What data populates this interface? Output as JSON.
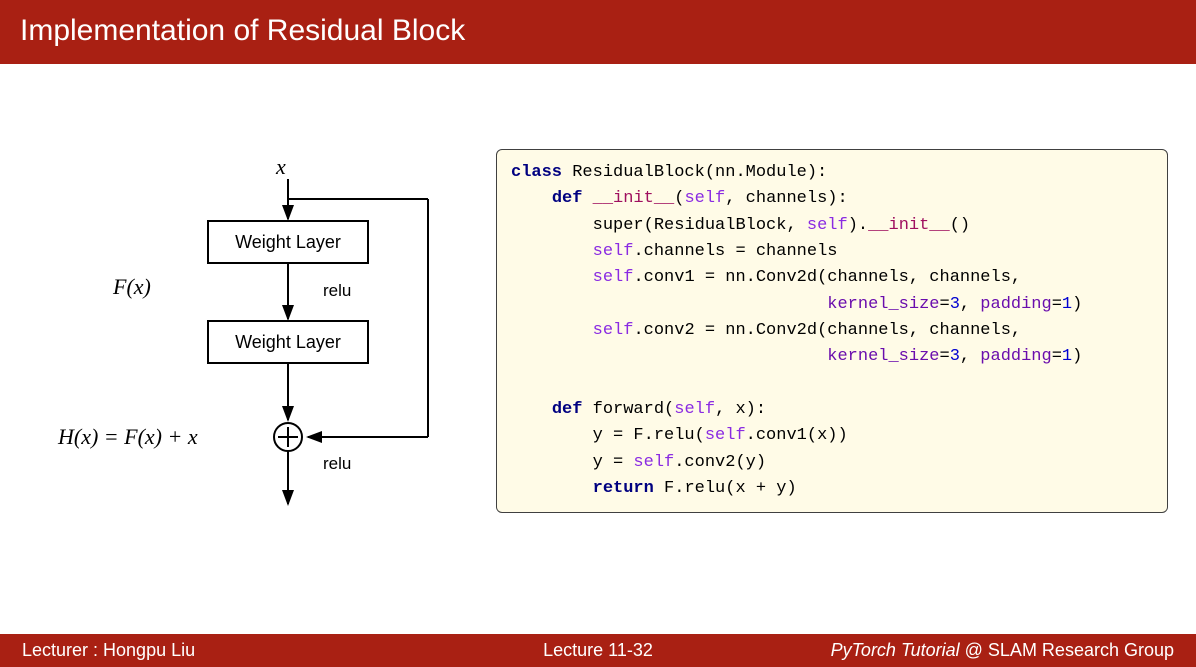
{
  "title": "Implementation of Residual Block",
  "diagram": {
    "input_label": "x",
    "layer1_label": "Weight Layer",
    "layer2_label": "Weight Layer",
    "relu1_label": "relu",
    "relu2_label": "relu",
    "fx_label": "F(x)",
    "hx_label": "H(x) = F(x) + x"
  },
  "code": {
    "class_kw": "class",
    "class_name": " ResidualBlock(nn.Module):",
    "def_kw": "def",
    "init_name": "__init__",
    "forward_name": "forward",
    "self_kw": "self",
    "return_kw": "return",
    "super_line1": "super",
    "super_line2": "(ResidualBlock, ",
    "super_line3": ").",
    "super_line4": "()",
    "ch_line": ".channels = channels",
    "conv1_a": ".conv1 = nn.Conv2d(channels, channels,",
    "conv1_b1": "kernel_size",
    "conv1_b2": "=",
    "conv1_b3": "3",
    "conv1_b4": ", ",
    "conv1_b5": "padding",
    "conv1_b6": "=",
    "conv1_b7": "1",
    "conv1_b8": ")",
    "conv2_a": ".conv2 = nn.Conv2d(channels, channels,",
    "fw_args": ", x):",
    "init_args": ", channels):",
    "y1a": "        y = F.relu(",
    "y1b": ".conv1(x))",
    "y2a": "        y = ",
    "y2b": ".conv2(y)",
    "ret_line": " F.relu(x + y)"
  },
  "footer": {
    "left": "Lecturer : Hongpu Liu",
    "center": "Lecture 11-32",
    "right_italic": "PyTorch Tutorial",
    "right_normal": " @ SLAM Research Group"
  }
}
